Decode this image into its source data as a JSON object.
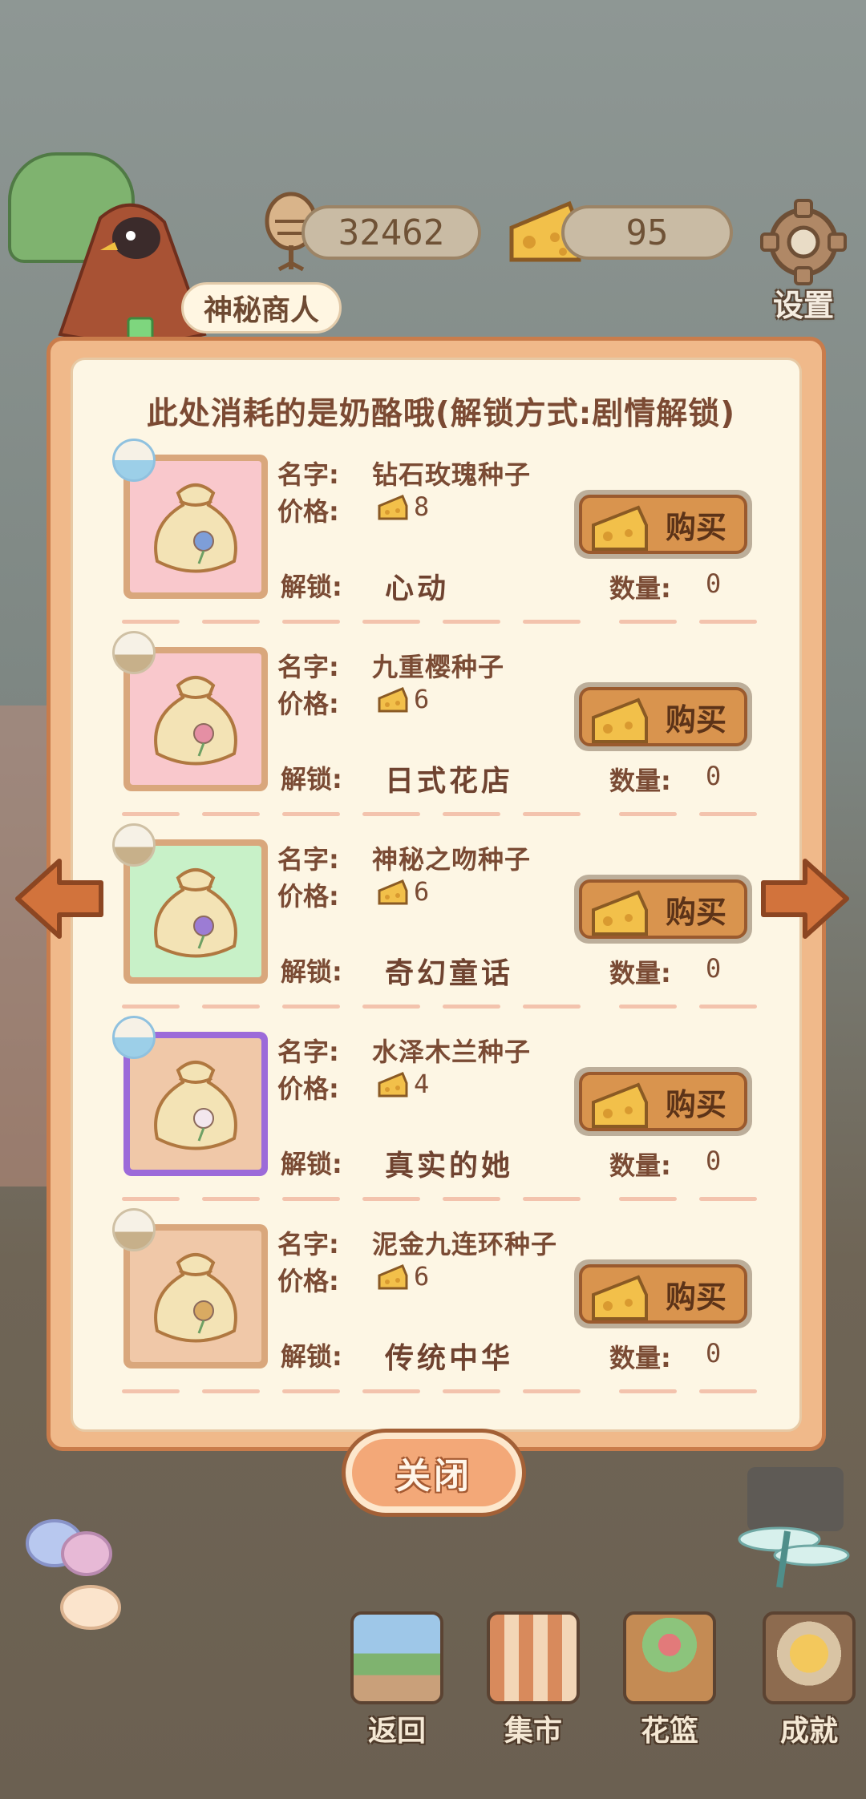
{
  "currencies": {
    "fish_value": "32462",
    "cheese_value": "95"
  },
  "settings": {
    "label": "设置",
    "icon": "gear-icon"
  },
  "dialog": {
    "merchant_name": "神秘商人",
    "notice": "此处消耗的是奶酪哦(解锁方式:剧情解锁)",
    "name_label": "名字:",
    "price_label": "价格:",
    "unlock_label": "解锁:",
    "qty_label": "数量:",
    "buy_label": "购买",
    "items": [
      {
        "name": "钻石玫瑰种子",
        "price": "8",
        "unlock": "心动",
        "qty": "0",
        "bg": "#f9c8cc",
        "badge": "water",
        "flower": "#7e9ed8"
      },
      {
        "name": "九重樱种子",
        "price": "6",
        "unlock": "日式花店",
        "qty": "0",
        "bg": "#f9c8cc",
        "badge": "soil",
        "flower": "#e58fa4"
      },
      {
        "name": "神秘之吻种子",
        "price": "6",
        "unlock": "奇幻童话",
        "qty": "0",
        "bg": "#c8f1c8",
        "badge": "soil",
        "flower": "#9c7cd4"
      },
      {
        "name": "水泽木兰种子",
        "price": "4",
        "unlock": "真实的她",
        "qty": "0",
        "bg": "#f0c8a8",
        "badge": "water",
        "flower": "#f3e7ee"
      },
      {
        "name": "泥金九连环种子",
        "price": "6",
        "unlock": "传统中华",
        "qty": "0",
        "bg": "#f0c8a8",
        "badge": "soil",
        "flower": "#d9aa62"
      }
    ],
    "close_label": "关闭"
  },
  "nav": {
    "back": "返回",
    "market": "集市",
    "basket": "花篮",
    "achievement": "成就"
  },
  "colors": {
    "panel": "#fdf6e4",
    "frame": "#f0b98a",
    "button": "#d9944e",
    "text": "#7a4b34"
  }
}
